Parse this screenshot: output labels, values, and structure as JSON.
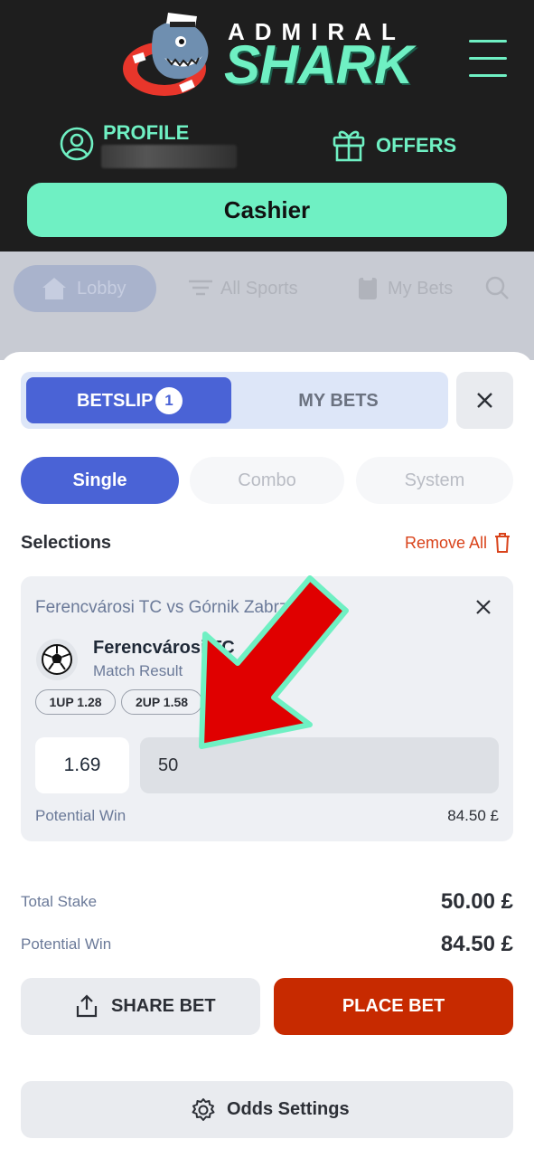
{
  "brand": {
    "line1": "ADMIRAL",
    "line2": "SHARK",
    "accent": "#6ff0c3"
  },
  "header": {
    "profile_label": "PROFILE",
    "offers_label": "OFFERS",
    "cashier_label": "Cashier"
  },
  "nav": {
    "lobby": "Lobby",
    "all_sports": "All Sports",
    "my_bets": "My Bets"
  },
  "betslip": {
    "tab_betslip": "BETSLIP",
    "badge_count": "1",
    "tab_mybets": "MY BETS",
    "bet_types": [
      "Single",
      "Combo",
      "System"
    ],
    "selections_title": "Selections",
    "remove_all": "Remove All",
    "selection": {
      "match": "Ferencvárosi TC vs Górnik Zabrze",
      "team": "Ferencvárosi TC",
      "market": "Match Result",
      "chips": [
        "1UP 1.28",
        "2UP 1.58"
      ],
      "odds": "1.69",
      "stake": "50",
      "potential_win_label": "Potential Win",
      "potential_win_value": "84.50 £"
    },
    "total_stake_label": "Total Stake",
    "total_stake_value": "50.00 £",
    "potential_win_label": "Potential Win",
    "potential_win_value": "84.50 £",
    "share_label": "SHARE BET",
    "place_label": "PLACE BET",
    "odds_settings_label": "Odds Settings",
    "place_color": "#c72a00",
    "primary_color": "#4a63d6"
  }
}
